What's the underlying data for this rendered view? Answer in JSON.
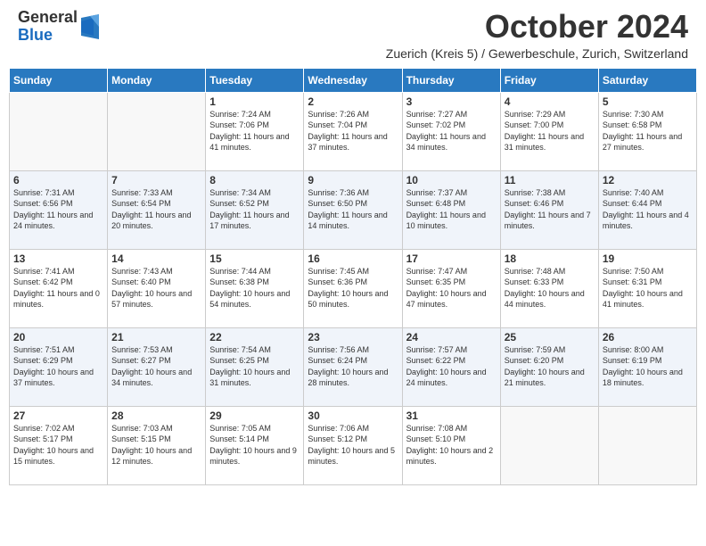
{
  "logo": {
    "general": "General",
    "blue": "Blue"
  },
  "title": "October 2024",
  "location": "Zuerich (Kreis 5) / Gewerbeschule, Zurich, Switzerland",
  "days_of_week": [
    "Sunday",
    "Monday",
    "Tuesday",
    "Wednesday",
    "Thursday",
    "Friday",
    "Saturday"
  ],
  "weeks": [
    [
      {
        "day": "",
        "info": ""
      },
      {
        "day": "",
        "info": ""
      },
      {
        "day": "1",
        "info": "Sunrise: 7:24 AM\nSunset: 7:06 PM\nDaylight: 11 hours and 41 minutes."
      },
      {
        "day": "2",
        "info": "Sunrise: 7:26 AM\nSunset: 7:04 PM\nDaylight: 11 hours and 37 minutes."
      },
      {
        "day": "3",
        "info": "Sunrise: 7:27 AM\nSunset: 7:02 PM\nDaylight: 11 hours and 34 minutes."
      },
      {
        "day": "4",
        "info": "Sunrise: 7:29 AM\nSunset: 7:00 PM\nDaylight: 11 hours and 31 minutes."
      },
      {
        "day": "5",
        "info": "Sunrise: 7:30 AM\nSunset: 6:58 PM\nDaylight: 11 hours and 27 minutes."
      }
    ],
    [
      {
        "day": "6",
        "info": "Sunrise: 7:31 AM\nSunset: 6:56 PM\nDaylight: 11 hours and 24 minutes."
      },
      {
        "day": "7",
        "info": "Sunrise: 7:33 AM\nSunset: 6:54 PM\nDaylight: 11 hours and 20 minutes."
      },
      {
        "day": "8",
        "info": "Sunrise: 7:34 AM\nSunset: 6:52 PM\nDaylight: 11 hours and 17 minutes."
      },
      {
        "day": "9",
        "info": "Sunrise: 7:36 AM\nSunset: 6:50 PM\nDaylight: 11 hours and 14 minutes."
      },
      {
        "day": "10",
        "info": "Sunrise: 7:37 AM\nSunset: 6:48 PM\nDaylight: 11 hours and 10 minutes."
      },
      {
        "day": "11",
        "info": "Sunrise: 7:38 AM\nSunset: 6:46 PM\nDaylight: 11 hours and 7 minutes."
      },
      {
        "day": "12",
        "info": "Sunrise: 7:40 AM\nSunset: 6:44 PM\nDaylight: 11 hours and 4 minutes."
      }
    ],
    [
      {
        "day": "13",
        "info": "Sunrise: 7:41 AM\nSunset: 6:42 PM\nDaylight: 11 hours and 0 minutes."
      },
      {
        "day": "14",
        "info": "Sunrise: 7:43 AM\nSunset: 6:40 PM\nDaylight: 10 hours and 57 minutes."
      },
      {
        "day": "15",
        "info": "Sunrise: 7:44 AM\nSunset: 6:38 PM\nDaylight: 10 hours and 54 minutes."
      },
      {
        "day": "16",
        "info": "Sunrise: 7:45 AM\nSunset: 6:36 PM\nDaylight: 10 hours and 50 minutes."
      },
      {
        "day": "17",
        "info": "Sunrise: 7:47 AM\nSunset: 6:35 PM\nDaylight: 10 hours and 47 minutes."
      },
      {
        "day": "18",
        "info": "Sunrise: 7:48 AM\nSunset: 6:33 PM\nDaylight: 10 hours and 44 minutes."
      },
      {
        "day": "19",
        "info": "Sunrise: 7:50 AM\nSunset: 6:31 PM\nDaylight: 10 hours and 41 minutes."
      }
    ],
    [
      {
        "day": "20",
        "info": "Sunrise: 7:51 AM\nSunset: 6:29 PM\nDaylight: 10 hours and 37 minutes."
      },
      {
        "day": "21",
        "info": "Sunrise: 7:53 AM\nSunset: 6:27 PM\nDaylight: 10 hours and 34 minutes."
      },
      {
        "day": "22",
        "info": "Sunrise: 7:54 AM\nSunset: 6:25 PM\nDaylight: 10 hours and 31 minutes."
      },
      {
        "day": "23",
        "info": "Sunrise: 7:56 AM\nSunset: 6:24 PM\nDaylight: 10 hours and 28 minutes."
      },
      {
        "day": "24",
        "info": "Sunrise: 7:57 AM\nSunset: 6:22 PM\nDaylight: 10 hours and 24 minutes."
      },
      {
        "day": "25",
        "info": "Sunrise: 7:59 AM\nSunset: 6:20 PM\nDaylight: 10 hours and 21 minutes."
      },
      {
        "day": "26",
        "info": "Sunrise: 8:00 AM\nSunset: 6:19 PM\nDaylight: 10 hours and 18 minutes."
      }
    ],
    [
      {
        "day": "27",
        "info": "Sunrise: 7:02 AM\nSunset: 5:17 PM\nDaylight: 10 hours and 15 minutes."
      },
      {
        "day": "28",
        "info": "Sunrise: 7:03 AM\nSunset: 5:15 PM\nDaylight: 10 hours and 12 minutes."
      },
      {
        "day": "29",
        "info": "Sunrise: 7:05 AM\nSunset: 5:14 PM\nDaylight: 10 hours and 9 minutes."
      },
      {
        "day": "30",
        "info": "Sunrise: 7:06 AM\nSunset: 5:12 PM\nDaylight: 10 hours and 5 minutes."
      },
      {
        "day": "31",
        "info": "Sunrise: 7:08 AM\nSunset: 5:10 PM\nDaylight: 10 hours and 2 minutes."
      },
      {
        "day": "",
        "info": ""
      },
      {
        "day": "",
        "info": ""
      }
    ]
  ]
}
